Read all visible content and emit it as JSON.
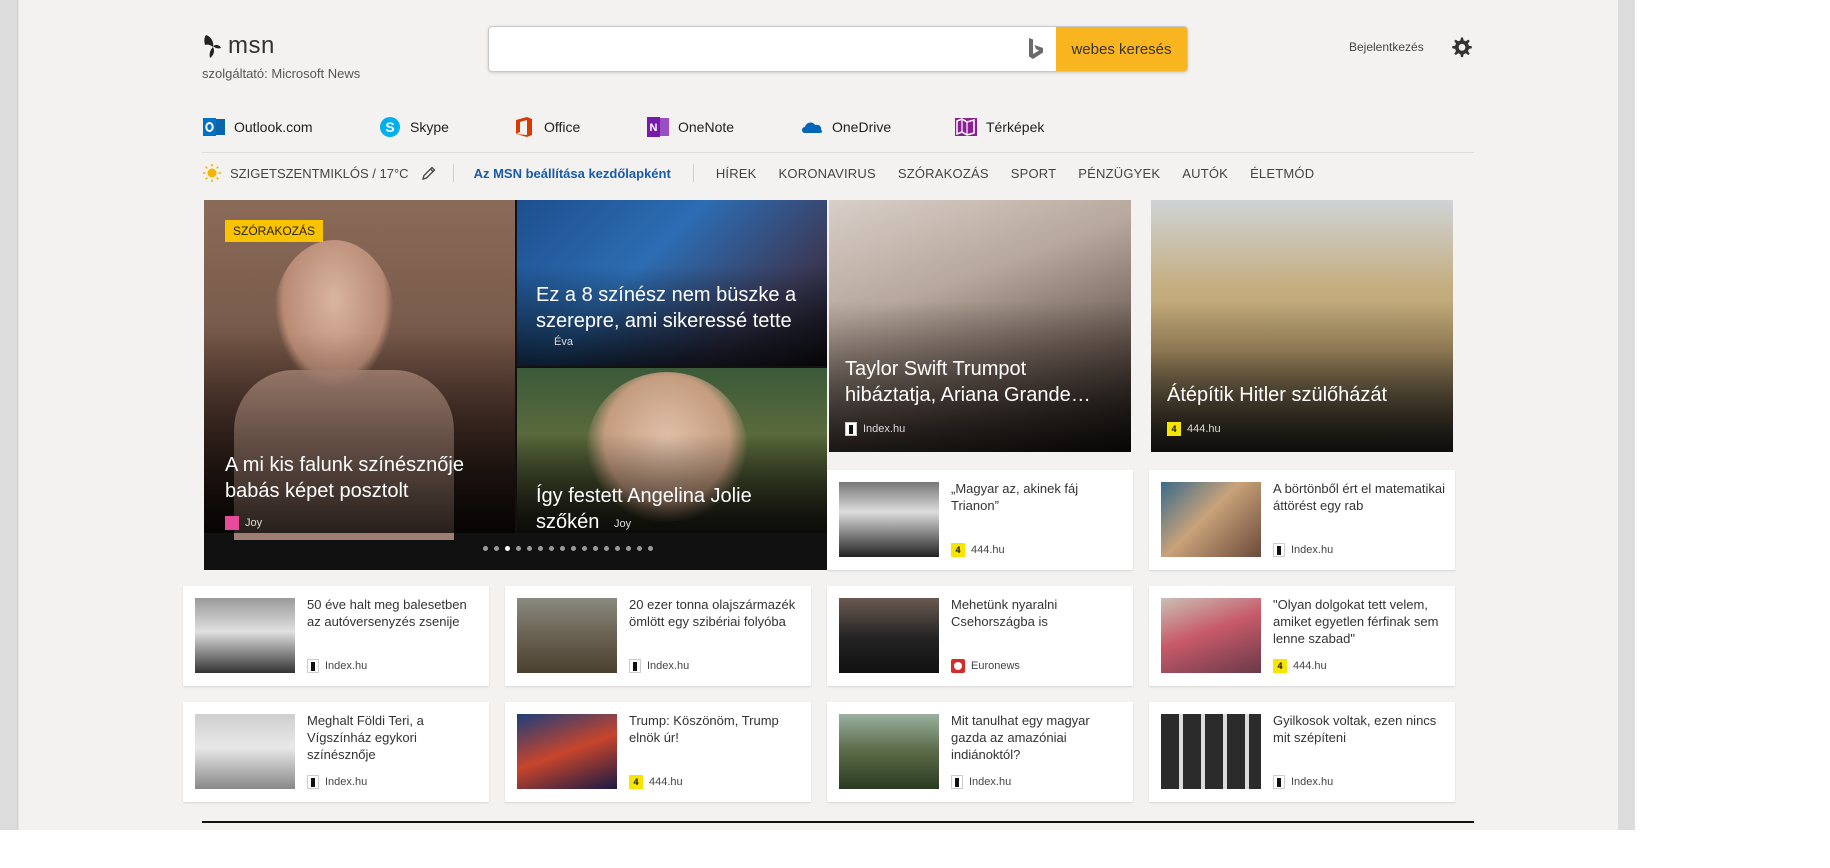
{
  "header": {
    "logo_text": "msn",
    "logo_subtitle": "szolgáltató: Microsoft News",
    "search_placeholder": "",
    "search_button": "webes keresés",
    "signin": "Bejelentkezés"
  },
  "apps": [
    {
      "label": "Outlook.com",
      "icon": "outlook-icon",
      "color": "#0072c6"
    },
    {
      "label": "Skype",
      "icon": "skype-icon",
      "color": "#00aff0"
    },
    {
      "label": "Office",
      "icon": "office-icon",
      "color": "#d83b01"
    },
    {
      "label": "OneNote",
      "icon": "onenote-icon",
      "color": "#7719aa"
    },
    {
      "label": "OneDrive",
      "icon": "onedrive-icon",
      "color": "#0364b8"
    },
    {
      "label": "Térképek",
      "icon": "maps-icon",
      "color": "#8a2094"
    }
  ],
  "nav": {
    "weather": "SZIGETSZENTMIKLÓS / 17°C",
    "set_home": "Az MSN beállítása kezdőlapként",
    "items": [
      "HÍREK",
      "KORONAVIRUS",
      "SZÓRAKOZÁS",
      "SPORT",
      "PÉNZÜGYEK",
      "AUTÓK",
      "ÉLETMÓD"
    ]
  },
  "hero": {
    "category": "SZÓRAKOZÁS",
    "main_title": "A mi kis falunk színésznője babás képet posztolt",
    "main_source": "Joy",
    "top_title": "Ez a 8 színész nem büszke a szerepre, ami sikeressé tette",
    "top_source": "Éva",
    "bottom_title": "Így festett Angelina Jolie szőkén",
    "bottom_source": "Joy",
    "dot_count": 16,
    "active_dot": 2
  },
  "big_cards": [
    {
      "title": "Taylor Swift Trumpot hibáztatja, Ariana Grande…",
      "source": "Index.hu",
      "source_type": "index"
    },
    {
      "title": "Átépítik Hitler szülőházát",
      "source": "444.hu",
      "source_type": "444"
    }
  ],
  "cards": [
    {
      "title": "„Magyar az, akinek fáj Trianon”",
      "source": "444.hu",
      "source_type": "444"
    },
    {
      "title": "A börtönből ért el matematikai áttörést egy rab",
      "source": "Index.hu",
      "source_type": "index"
    },
    {
      "title": "50 éve halt meg balesetben az autóversenyzés zsenije",
      "source": "Index.hu",
      "source_type": "index"
    },
    {
      "title": "20 ezer tonna olajszármazék ömlött egy szibériai folyóba",
      "source": "Index.hu",
      "source_type": "index"
    },
    {
      "title": "Mehetünk nyaralni Csehországba is",
      "source": "Euronews",
      "source_type": "euro"
    },
    {
      "title": "\"Olyan dolgokat tett velem, amiket egyetlen férfinak sem lenne szabad\"",
      "source": "444.hu",
      "source_type": "444"
    },
    {
      "title": "Meghalt Földi Teri, a Vígszínház egykori színésznője",
      "source": "Index.hu",
      "source_type": "index"
    },
    {
      "title": "Trump: Köszönöm, Trump elnök úr!",
      "source": "444.hu",
      "source_type": "444"
    },
    {
      "title": "Mit tanulhat egy magyar gazda az amazóniai indiánoktól?",
      "source": "Index.hu",
      "source_type": "index"
    },
    {
      "title": "Gyilkosok voltak, ezen nincs mit szépíteni",
      "source": "Index.hu",
      "source_type": "index"
    }
  ],
  "colors": {
    "accent": "#f9b51f",
    "link": "#1b5aa8",
    "badge": "#f9c300"
  }
}
